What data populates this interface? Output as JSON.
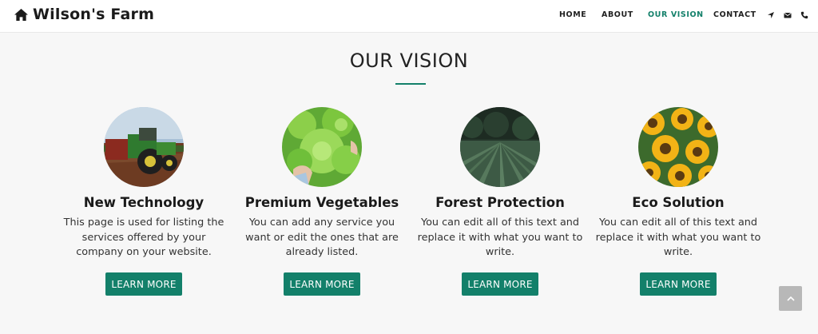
{
  "brand": {
    "name": "Wilson's Farm",
    "icon": "home-icon"
  },
  "nav": {
    "items": [
      {
        "label": "HOME"
      },
      {
        "label": "ABOUT"
      },
      {
        "label": "OUR VISION",
        "active": true
      },
      {
        "label": "CONTACT"
      }
    ],
    "icons": [
      "location-arrow-icon",
      "envelope-icon",
      "phone-icon"
    ]
  },
  "section": {
    "title": "OUR VISION"
  },
  "cards": [
    {
      "title": "New Technology",
      "text": "This page is used for listing the services offered by your company on your website.",
      "button": "LEARN MORE",
      "image": "tractor-photo"
    },
    {
      "title": "Premium Vegetables",
      "text": "You can add any service you want or edit the ones that are already listed.",
      "button": "LEARN MORE",
      "image": "lettuce-photo"
    },
    {
      "title": "Forest Protection",
      "text": "You can edit all of this text and replace it with what you want to write.",
      "button": "LEARN MORE",
      "image": "crop-field-photo"
    },
    {
      "title": "Eco Solution",
      "text": "You can edit all of this text and replace it with what you want to write.",
      "button": "LEARN MORE",
      "image": "sunflowers-photo"
    }
  ],
  "colors": {
    "accent": "#13806a",
    "background": "#f7f7f7",
    "header": "#ffffff",
    "back_to_top": "#b8b8b8"
  },
  "back_to_top": {
    "icon": "chevron-up-icon"
  }
}
